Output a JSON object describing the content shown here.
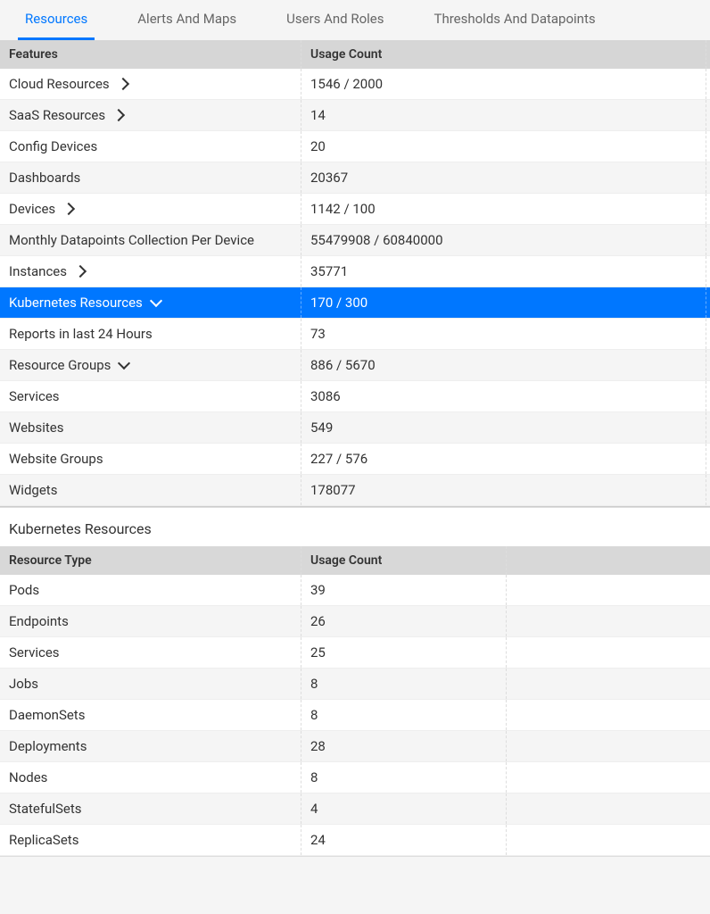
{
  "tabs": {
    "resources": "Resources",
    "alerts": "Alerts And Maps",
    "users": "Users And Roles",
    "thresholds": "Thresholds And Datapoints"
  },
  "mainTable": {
    "header": {
      "features": "Features",
      "usage": "Usage Count"
    },
    "rows": {
      "cloud": {
        "label": "Cloud Resources",
        "value": "1546 / 2000"
      },
      "saas": {
        "label": "SaaS Resources",
        "value": "14"
      },
      "config": {
        "label": "Config Devices",
        "value": "20"
      },
      "dashboards": {
        "label": "Dashboards",
        "value": "20367"
      },
      "devices": {
        "label": "Devices",
        "value": "1142 / 100"
      },
      "monthly": {
        "label": "Monthly Datapoints Collection Per Device",
        "value": "55479908 / 60840000"
      },
      "instances": {
        "label": "Instances",
        "value": "35771"
      },
      "kubernetes": {
        "label": "Kubernetes Resources",
        "value": "170 / 300"
      },
      "reports": {
        "label": "Reports in last 24 Hours",
        "value": "73"
      },
      "resourceGroups": {
        "label": "Resource Groups",
        "value": "886 / 5670"
      },
      "services": {
        "label": "Services",
        "value": "3086"
      },
      "websites": {
        "label": "Websites",
        "value": "549"
      },
      "websiteGroups": {
        "label": "Website Groups",
        "value": "227 / 576"
      },
      "widgets": {
        "label": "Widgets",
        "value": "178077"
      }
    }
  },
  "subSection": {
    "title": "Kubernetes Resources",
    "header": {
      "type": "Resource Type",
      "usage": "Usage Count"
    },
    "rows": {
      "pods": {
        "label": "Pods",
        "value": "39"
      },
      "endpoints": {
        "label": "Endpoints",
        "value": "26"
      },
      "services": {
        "label": "Services",
        "value": "25"
      },
      "jobs": {
        "label": "Jobs",
        "value": "8"
      },
      "daemonsets": {
        "label": "DaemonSets",
        "value": "8"
      },
      "deployments": {
        "label": "Deployments",
        "value": "28"
      },
      "nodes": {
        "label": "Nodes",
        "value": "8"
      },
      "statefulsets": {
        "label": "StatefulSets",
        "value": "4"
      },
      "replicasets": {
        "label": "ReplicaSets",
        "value": "24"
      }
    }
  }
}
